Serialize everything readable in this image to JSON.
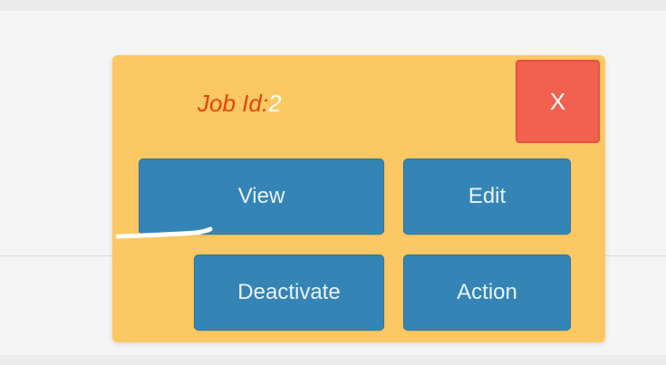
{
  "popup": {
    "job_id_label": "Job Id:",
    "job_id_value": "2",
    "close_label": "X",
    "buttons": {
      "view": "View",
      "edit": "Edit",
      "deactivate": "Deactivate",
      "action": "Action"
    }
  },
  "colors": {
    "popup_background": "#fcc863",
    "label_accent": "#e5430e",
    "close_button": "#f2604f",
    "action_button": "#3485b6"
  }
}
